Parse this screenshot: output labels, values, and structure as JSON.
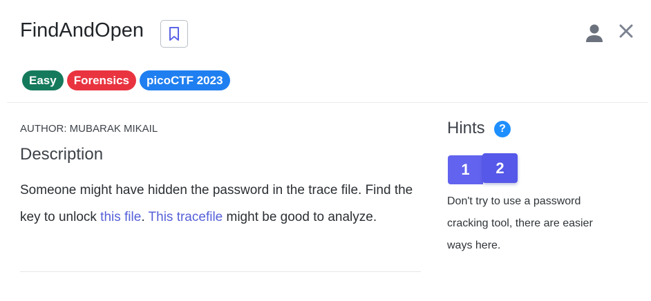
{
  "header": {
    "title": "FindAndOpen",
    "icons": {
      "bookmark": "bookmark-icon",
      "user": "user-icon",
      "close": "close-icon"
    }
  },
  "tags": [
    {
      "label": "Easy",
      "color": "#157a5c"
    },
    {
      "label": "Forensics",
      "color": "#e93440"
    },
    {
      "label": "picoCTF 2023",
      "color": "#1f7ff0"
    }
  ],
  "author": "AUTHOR: MUBARAK MIKAIL",
  "description": {
    "heading": "Description",
    "text_1": "Someone might have hidden the password in the trace file. Find the key to unlock ",
    "link_1": "this file",
    "text_2": ". ",
    "link_2": "This tracefile",
    "text_3": " might be good to analyze."
  },
  "hints": {
    "heading": "Hints",
    "help_icon": "?",
    "buttons": [
      "1",
      "2"
    ],
    "active": "2",
    "text": "Don't try to use a password cracking tool, there are easier ways here."
  },
  "colors": {
    "accent": "#6263ef",
    "link": "#5560d8"
  }
}
